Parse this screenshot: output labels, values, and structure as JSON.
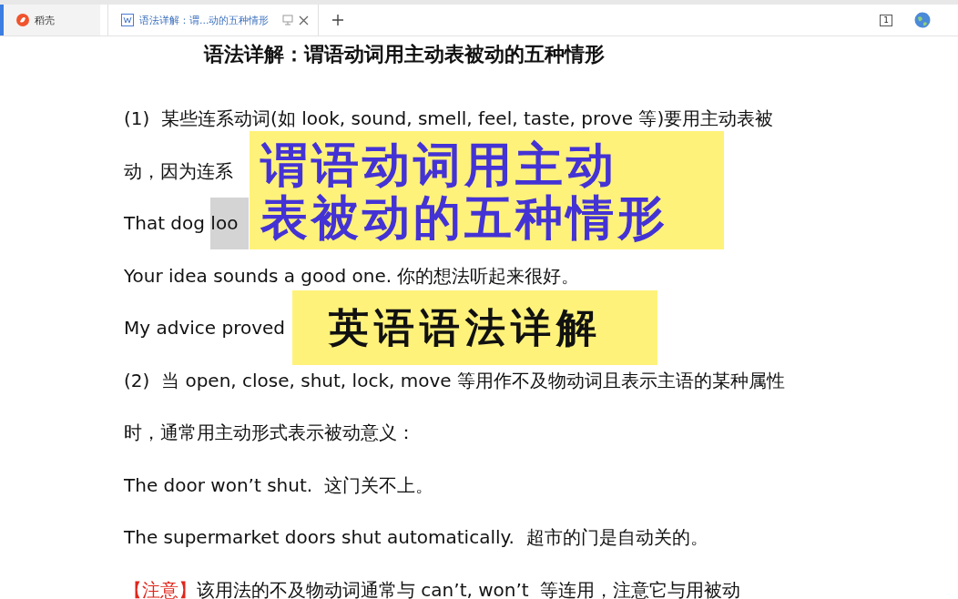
{
  "tabs": [
    {
      "label": "稻壳",
      "kind": "home",
      "selected": false
    },
    {
      "label": "语法详解：谓...动的五种情形",
      "kind": "doc",
      "selected": true
    }
  ],
  "toolbar": {
    "page_count": "1"
  },
  "document": {
    "title": "语法详解：谓语动词用主动表被动的五种情形",
    "lines": [
      {
        "text": "(1)  某些连系动词(如 look, sound, smell, feel, taste, prove 等)要用主动表被"
      },
      {
        "text": "动，因为连系"
      },
      {
        "text": "That dog ",
        "highlight": "loo"
      },
      {
        "text": "Your idea sounds a good one. 你的想法听起来很好。"
      },
      {
        "text": "My advice proved"
      },
      {
        "text": "(2)  当 open, close, shut, lock, move 等用作不及物动词且表示主语的某种属性"
      },
      {
        "text": "时，通常用主动形式表示被动意义："
      },
      {
        "text": "The door won’t shut.  这门关不上。"
      },
      {
        "text": "The supermarket doors shut automatically.  超市的门是自动关的。"
      },
      {
        "label": "【注意】",
        "text": "该用法的不及物动词通常与 can’t, won’t  等连用，注意它与用被动"
      }
    ]
  },
  "banners": [
    {
      "lines": [
        "谓语动词用主动",
        "表被动的五种情形"
      ],
      "kind": "main"
    },
    {
      "lines": [
        "英语语法详解"
      ],
      "kind": "sub"
    }
  ]
}
